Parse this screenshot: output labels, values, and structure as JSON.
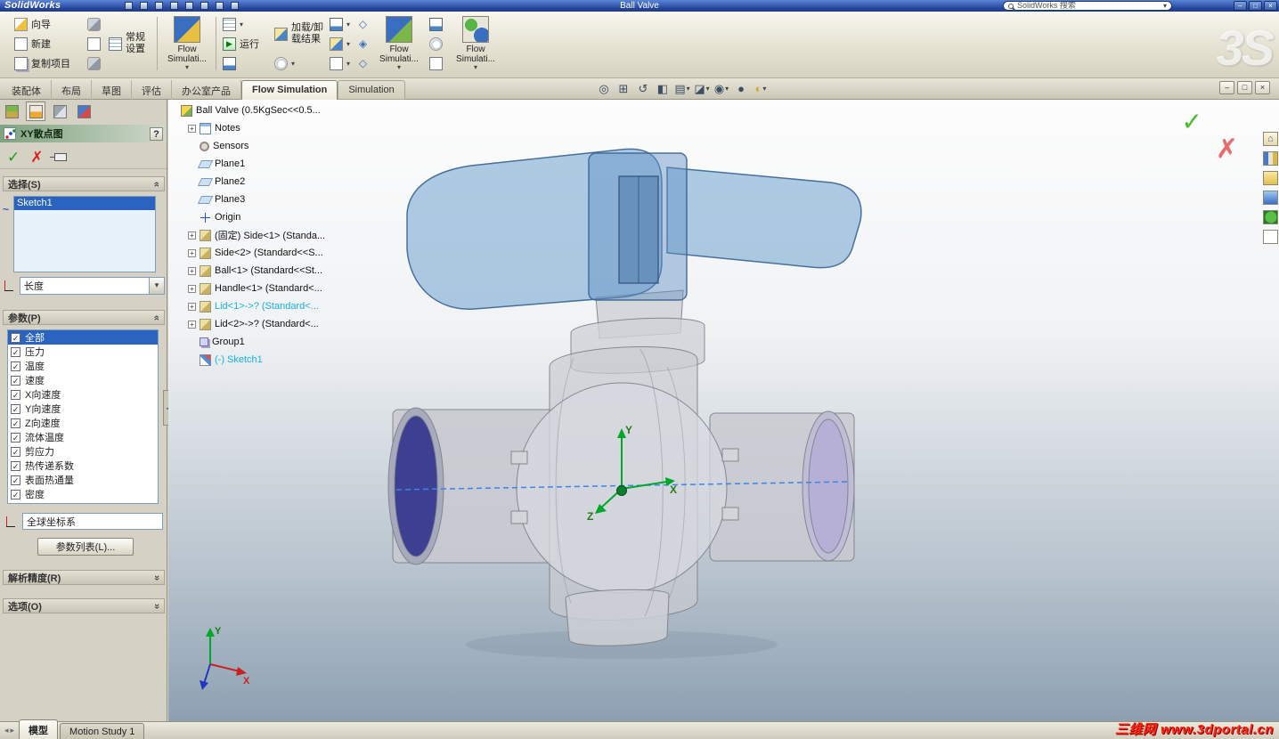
{
  "titlebar": {
    "app_logo": "SolidWorks",
    "doc_title": "Ball Valve",
    "search": "SolidWorks 搜索"
  },
  "brand_watermark": "3S",
  "ribbon": {
    "wizard": "向导",
    "new": "新建",
    "copy_project": "复制项目",
    "general_settings": "常规设置",
    "flow_sim_main": "Flow Simulati...",
    "run": "运行",
    "load_unload_results": "加载/卸载结果",
    "flow_sim_tools": "Flow Simulati...",
    "flow_sim_results": "Flow Simulati..."
  },
  "tabs": [
    "装配体",
    "布局",
    "草图",
    "评估",
    "办公室产品",
    "Flow Simulation",
    "Simulation"
  ],
  "icons": {
    "check": "✓",
    "cross": "✗",
    "plus": "+",
    "dropdown": "▾",
    "chevron": "»",
    "zoom_fit": "◎",
    "zoom_area": "⊞",
    "rotate_view": "↺",
    "section_view": "◧",
    "view_orientation": "▤",
    "display_style": "◪",
    "hide_show_items": "◉",
    "edit_appearance": "●",
    "apply_scene": "◐",
    "curve": "~",
    "house": "⌂",
    "minimize": "–",
    "restore": "□",
    "close": "×",
    "help": "?",
    "run_arrow": "▶",
    "scroll_arrows": "◂▸"
  },
  "property_panel": {
    "title": "XY散点图",
    "sections": {
      "selection": "选择(S)",
      "parameters": "参数(P)",
      "resolution": "解析精度(R)",
      "options": "选项(O)"
    },
    "selection_items": [
      {
        "label": "Sketch1",
        "selected": true
      }
    ],
    "abscissa": "长度",
    "parameters": [
      {
        "label": "全部",
        "checked": true,
        "selected": true
      },
      {
        "label": "压力",
        "checked": true
      },
      {
        "label": "温度",
        "checked": true
      },
      {
        "label": "速度",
        "checked": true
      },
      {
        "label": "X向速度",
        "checked": true
      },
      {
        "label": "Y向速度",
        "checked": true
      },
      {
        "label": "Z向速度",
        "checked": true
      },
      {
        "label": "流体温度",
        "checked": true
      },
      {
        "label": "剪应力",
        "checked": true
      },
      {
        "label": "热传递系数",
        "checked": true
      },
      {
        "label": "表面热通量",
        "checked": true
      },
      {
        "label": "密度",
        "checked": true
      }
    ],
    "coordinate_system": "全球坐标系",
    "parameter_list_button": "参数列表(L)..."
  },
  "feature_tree": [
    {
      "label": "Ball Valve  (0.5KgSec<<0.5...",
      "icon": "assembly"
    },
    {
      "label": "Notes",
      "icon": "notes",
      "plus": true
    },
    {
      "label": "Sensors",
      "icon": "sensors"
    },
    {
      "label": "Plane1",
      "icon": "plane"
    },
    {
      "label": "Plane2",
      "icon": "plane"
    },
    {
      "label": "Plane3",
      "icon": "plane"
    },
    {
      "label": "Origin",
      "icon": "origin"
    },
    {
      "label": "(固定) Side<1> (Standa...",
      "icon": "part",
      "plus": true
    },
    {
      "label": "Side<2> (Standard<<S...",
      "icon": "part",
      "plus": true
    },
    {
      "label": "Ball<1> (Standard<<St...",
      "icon": "part",
      "plus": true
    },
    {
      "label": "Handle<1> (Standard<...",
      "icon": "part",
      "plus": true
    },
    {
      "label": "Lid<1>->? (Standard<...",
      "icon": "part",
      "plus": true,
      "highlighted": true
    },
    {
      "label": "Lid<2>->? (Standard<...",
      "icon": "part",
      "plus": true
    },
    {
      "label": "Group1",
      "icon": "group"
    },
    {
      "label": "(-) Sketch1",
      "icon": "sketch",
      "highlighted": true
    }
  ],
  "viewport": {
    "triad": {
      "x": "X",
      "y": "Y",
      "z": "Z"
    }
  },
  "status_bar": {
    "tabs": [
      {
        "label": "模型",
        "active": true
      },
      {
        "label": "Motion Study 1",
        "active": false
      }
    ],
    "watermark": "三维网 www.3dportal.cn"
  }
}
